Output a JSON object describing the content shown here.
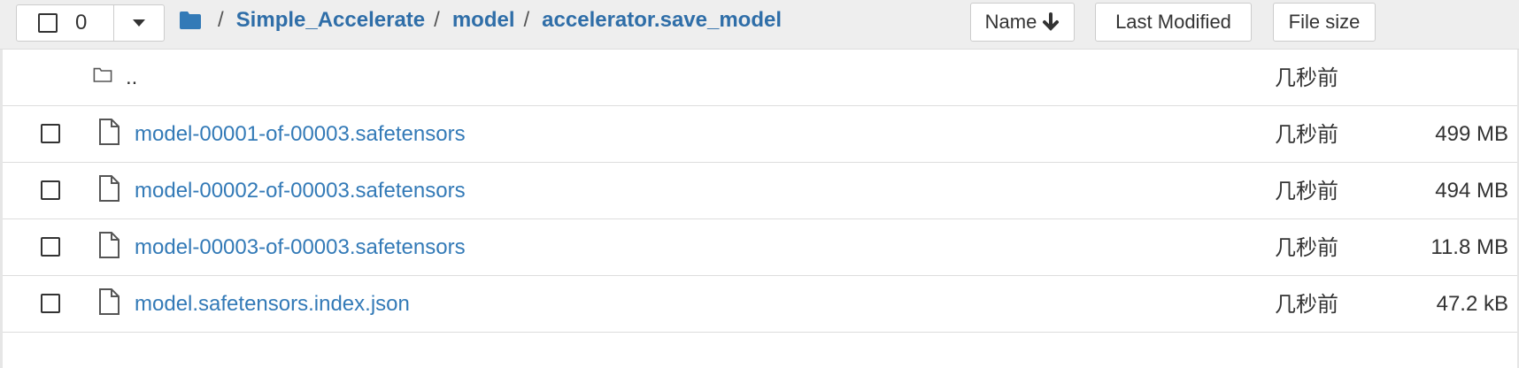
{
  "header": {
    "selected_count": "0",
    "breadcrumb": [
      "Simple_Accelerate",
      "model",
      "accelerator.save_model"
    ],
    "separator": "/",
    "sort": {
      "name_label": "Name",
      "name_arrow": "🡓",
      "last_modified_label": "Last Modified",
      "file_size_label": "File size"
    }
  },
  "rows": [
    {
      "name": "..",
      "type": "folder",
      "modified": "几秒前",
      "size": ""
    },
    {
      "name": "model-00001-of-00003.safetensors",
      "type": "file",
      "modified": "几秒前",
      "size": "499 MB"
    },
    {
      "name": "model-00002-of-00003.safetensors",
      "type": "file",
      "modified": "几秒前",
      "size": "494 MB"
    },
    {
      "name": "model-00003-of-00003.safetensors",
      "type": "file",
      "modified": "几秒前",
      "size": "11.8 MB"
    },
    {
      "name": "model.safetensors.index.json",
      "type": "file",
      "modified": "几秒前",
      "size": "47.2 kB"
    }
  ],
  "colors": {
    "link": "#337ab7",
    "header_bg": "#eeeeee",
    "border": "#dddddd"
  }
}
